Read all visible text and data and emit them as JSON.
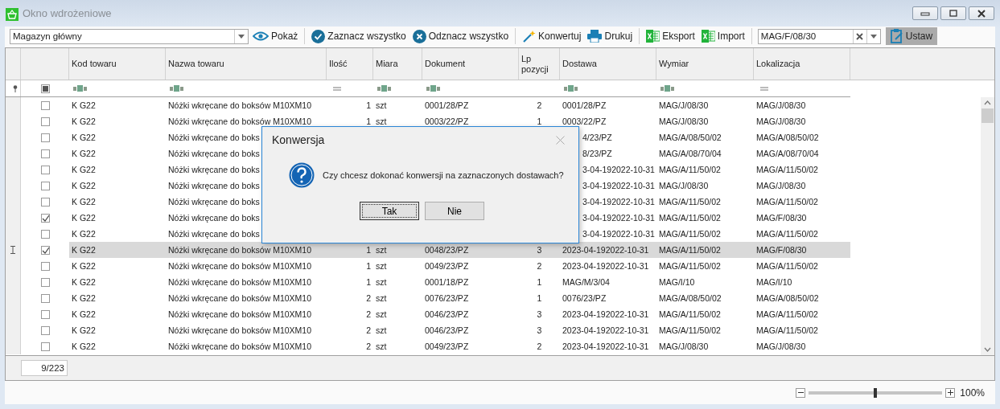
{
  "window": {
    "title": "Okno wdrożeniowe"
  },
  "toolbar": {
    "warehouse": "Magazyn główny",
    "buttons": [
      {
        "kind": "eye",
        "label": "Pokaż",
        "sep_after": true
      },
      {
        "kind": "check",
        "label": "Zaznacz wszystko",
        "sep_after": false
      },
      {
        "kind": "uncheck",
        "label": "Odznacz wszystko",
        "sep_after": true
      },
      {
        "kind": "wand",
        "label": "Konwertuj",
        "sep_after": false
      },
      {
        "kind": "print",
        "label": "Drukuj",
        "sep_after": true
      },
      {
        "kind": "excel",
        "label": "Eksport",
        "sep_after": false
      },
      {
        "kind": "excel",
        "label": "Import",
        "sep_after": true
      }
    ],
    "location": "MAG/F/08/30",
    "apply": {
      "label": "Ustaw",
      "pressed": true
    }
  },
  "table": {
    "columns": [
      {
        "label": "Kod towaru",
        "kind": "text"
      },
      {
        "label": "Nazwa towaru",
        "kind": "text"
      },
      {
        "label": "Ilość",
        "kind": "number"
      },
      {
        "label": "Miara",
        "kind": "text"
      },
      {
        "label": "Dokument",
        "kind": "text"
      },
      {
        "label": "Lp pozycji",
        "kind": "index"
      },
      {
        "label": "Dostawa",
        "kind": "text"
      },
      {
        "label": "Wymiar",
        "kind": "text"
      },
      {
        "label": "Lokalizacja",
        "kind": "number"
      }
    ],
    "select_all": {
      "partial": true
    },
    "rows": [
      {
        "checked": false,
        "selected": false,
        "covered": false,
        "cells": [
          "K G22",
          "Nóżki wkręcane do boksów M10XM10",
          "1",
          "szt",
          "0001/28/PZ",
          "2",
          "0001/28/PZ",
          "MAG/J/08/30",
          "MAG/J/08/30"
        ]
      },
      {
        "checked": false,
        "selected": false,
        "covered": false,
        "cells": [
          "K G22",
          "Nóżki wkręcane do boksów M10XM10",
          "1",
          "szt",
          "0003/22/PZ",
          "1",
          "0003/22/PZ",
          "MAG/J/08/30",
          "MAG/J/08/30"
        ]
      },
      {
        "checked": false,
        "selected": false,
        "covered": true,
        "cells": [
          "K G22",
          "Nóżki wkręcane do boks",
          "4/23/PZ",
          "MAG/A/08/50/02",
          "MAG/A/08/50/02"
        ]
      },
      {
        "checked": false,
        "selected": false,
        "covered": true,
        "cells": [
          "K G22",
          "Nóżki wkręcane do boks",
          "8/23/PZ",
          "MAG/A/08/70/04",
          "MAG/A/08/70/04"
        ]
      },
      {
        "checked": false,
        "selected": false,
        "covered": true,
        "cells": [
          "K G22",
          "Nóżki wkręcane do boks",
          "3-04-192022-10-31",
          "MAG/A/11/50/02",
          "MAG/A/11/50/02"
        ]
      },
      {
        "checked": false,
        "selected": false,
        "covered": true,
        "cells": [
          "K G22",
          "Nóżki wkręcane do boks",
          "3-04-192022-10-31",
          "MAG/J/08/30",
          "MAG/J/08/30"
        ]
      },
      {
        "checked": false,
        "selected": false,
        "covered": true,
        "cells": [
          "K G22",
          "Nóżki wkręcane do boks",
          "3-04-192022-10-31",
          "MAG/A/11/50/02",
          "MAG/A/11/50/02"
        ]
      },
      {
        "checked": true,
        "selected": false,
        "covered": true,
        "cells": [
          "K G22",
          "Nóżki wkręcane do boks",
          "3-04-192022-10-31",
          "MAG/A/11/50/02",
          "MAG/F/08/30"
        ]
      },
      {
        "checked": false,
        "selected": false,
        "covered": true,
        "cells": [
          "K G22",
          "Nóżki wkręcane do boks",
          "3-04-192022-10-31",
          "MAG/A/11/50/02",
          "MAG/A/11/50/02"
        ]
      },
      {
        "checked": true,
        "selected": true,
        "covered": false,
        "cells": [
          "K G22",
          "Nóżki wkręcane do boksów M10XM10",
          "1",
          "szt",
          "0048/23/PZ",
          "3",
          "2023-04-192022-10-31",
          "MAG/A/11/50/02",
          "MAG/F/08/30"
        ]
      },
      {
        "checked": false,
        "selected": false,
        "covered": false,
        "cells": [
          "K G22",
          "Nóżki wkręcane do boksów M10XM10",
          "1",
          "szt",
          "0049/23/PZ",
          "2",
          "2023-04-192022-10-31",
          "MAG/A/11/50/02",
          "MAG/A/11/50/02"
        ]
      },
      {
        "checked": false,
        "selected": false,
        "covered": false,
        "cells": [
          "K G22",
          "Nóżki wkręcane do boksów M10XM10",
          "1",
          "szt",
          "0001/18/PZ",
          "1",
          "MAG/M/3/04",
          "MAG/I/10",
          "MAG/I/10"
        ]
      },
      {
        "checked": false,
        "selected": false,
        "covered": false,
        "cells": [
          "K G22",
          "Nóżki wkręcane do boksów M10XM10",
          "2",
          "szt",
          "0076/23/PZ",
          "1",
          "0076/23/PZ",
          "MAG/A/08/50/02",
          "MAG/A/08/50/02"
        ]
      },
      {
        "checked": false,
        "selected": false,
        "covered": false,
        "cells": [
          "K G22",
          "Nóżki wkręcane do boksów M10XM10",
          "2",
          "szt",
          "0046/23/PZ",
          "3",
          "2023-04-192022-10-31",
          "MAG/A/11/50/02",
          "MAG/A/11/50/02"
        ]
      },
      {
        "checked": false,
        "selected": false,
        "covered": false,
        "cells": [
          "K G22",
          "Nóżki wkręcane do boksów M10XM10",
          "2",
          "szt",
          "0046/23/PZ",
          "3",
          "2023-04-192022-10-31",
          "MAG/A/11/50/02",
          "MAG/A/11/50/02"
        ]
      },
      {
        "checked": false,
        "selected": false,
        "covered": false,
        "cells": [
          "K G22",
          "Nóżki wkręcane do boksów M10XM10",
          "2",
          "szt",
          "0049/23/PZ",
          "2",
          "2023-04-192022-10-31",
          "MAG/J/08/30",
          "MAG/J/08/30"
        ]
      }
    ],
    "counter": "9/223"
  },
  "zoom": {
    "level": 0.5,
    "reading": "100%"
  },
  "dialog": {
    "title": "Konwersja",
    "message": "Czy chcesz dokonać konwersji na zaznaczonych dostawach?",
    "buttons": [
      {
        "label": "Tak",
        "default": true
      },
      {
        "label": "Nie",
        "default": false
      }
    ]
  }
}
